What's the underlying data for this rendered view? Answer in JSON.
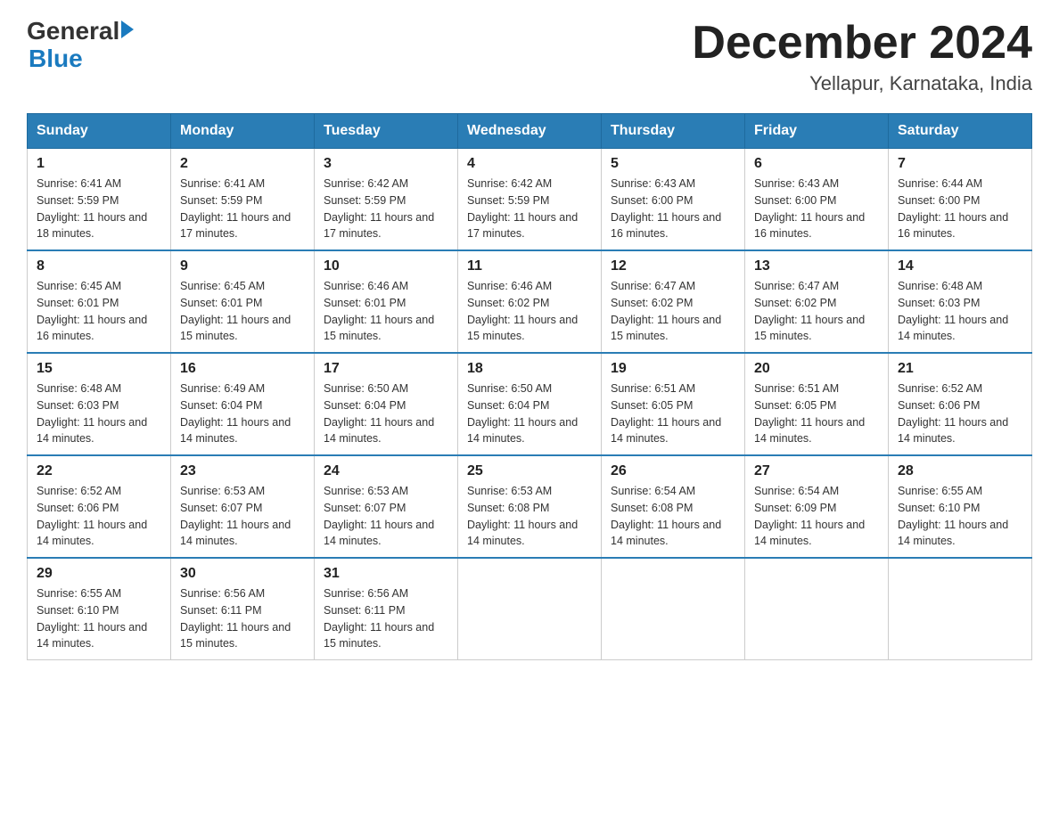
{
  "logo": {
    "text_general": "General",
    "text_blue": "Blue"
  },
  "title": "December 2024",
  "location": "Yellapur, Karnataka, India",
  "headers": [
    "Sunday",
    "Monday",
    "Tuesday",
    "Wednesday",
    "Thursday",
    "Friday",
    "Saturday"
  ],
  "weeks": [
    [
      {
        "day": "1",
        "sunrise": "6:41 AM",
        "sunset": "5:59 PM",
        "daylight": "11 hours and 18 minutes."
      },
      {
        "day": "2",
        "sunrise": "6:41 AM",
        "sunset": "5:59 PM",
        "daylight": "11 hours and 17 minutes."
      },
      {
        "day": "3",
        "sunrise": "6:42 AM",
        "sunset": "5:59 PM",
        "daylight": "11 hours and 17 minutes."
      },
      {
        "day": "4",
        "sunrise": "6:42 AM",
        "sunset": "5:59 PM",
        "daylight": "11 hours and 17 minutes."
      },
      {
        "day": "5",
        "sunrise": "6:43 AM",
        "sunset": "6:00 PM",
        "daylight": "11 hours and 16 minutes."
      },
      {
        "day": "6",
        "sunrise": "6:43 AM",
        "sunset": "6:00 PM",
        "daylight": "11 hours and 16 minutes."
      },
      {
        "day": "7",
        "sunrise": "6:44 AM",
        "sunset": "6:00 PM",
        "daylight": "11 hours and 16 minutes."
      }
    ],
    [
      {
        "day": "8",
        "sunrise": "6:45 AM",
        "sunset": "6:01 PM",
        "daylight": "11 hours and 16 minutes."
      },
      {
        "day": "9",
        "sunrise": "6:45 AM",
        "sunset": "6:01 PM",
        "daylight": "11 hours and 15 minutes."
      },
      {
        "day": "10",
        "sunrise": "6:46 AM",
        "sunset": "6:01 PM",
        "daylight": "11 hours and 15 minutes."
      },
      {
        "day": "11",
        "sunrise": "6:46 AM",
        "sunset": "6:02 PM",
        "daylight": "11 hours and 15 minutes."
      },
      {
        "day": "12",
        "sunrise": "6:47 AM",
        "sunset": "6:02 PM",
        "daylight": "11 hours and 15 minutes."
      },
      {
        "day": "13",
        "sunrise": "6:47 AM",
        "sunset": "6:02 PM",
        "daylight": "11 hours and 15 minutes."
      },
      {
        "day": "14",
        "sunrise": "6:48 AM",
        "sunset": "6:03 PM",
        "daylight": "11 hours and 14 minutes."
      }
    ],
    [
      {
        "day": "15",
        "sunrise": "6:48 AM",
        "sunset": "6:03 PM",
        "daylight": "11 hours and 14 minutes."
      },
      {
        "day": "16",
        "sunrise": "6:49 AM",
        "sunset": "6:04 PM",
        "daylight": "11 hours and 14 minutes."
      },
      {
        "day": "17",
        "sunrise": "6:50 AM",
        "sunset": "6:04 PM",
        "daylight": "11 hours and 14 minutes."
      },
      {
        "day": "18",
        "sunrise": "6:50 AM",
        "sunset": "6:04 PM",
        "daylight": "11 hours and 14 minutes."
      },
      {
        "day": "19",
        "sunrise": "6:51 AM",
        "sunset": "6:05 PM",
        "daylight": "11 hours and 14 minutes."
      },
      {
        "day": "20",
        "sunrise": "6:51 AM",
        "sunset": "6:05 PM",
        "daylight": "11 hours and 14 minutes."
      },
      {
        "day": "21",
        "sunrise": "6:52 AM",
        "sunset": "6:06 PM",
        "daylight": "11 hours and 14 minutes."
      }
    ],
    [
      {
        "day": "22",
        "sunrise": "6:52 AM",
        "sunset": "6:06 PM",
        "daylight": "11 hours and 14 minutes."
      },
      {
        "day": "23",
        "sunrise": "6:53 AM",
        "sunset": "6:07 PM",
        "daylight": "11 hours and 14 minutes."
      },
      {
        "day": "24",
        "sunrise": "6:53 AM",
        "sunset": "6:07 PM",
        "daylight": "11 hours and 14 minutes."
      },
      {
        "day": "25",
        "sunrise": "6:53 AM",
        "sunset": "6:08 PM",
        "daylight": "11 hours and 14 minutes."
      },
      {
        "day": "26",
        "sunrise": "6:54 AM",
        "sunset": "6:08 PM",
        "daylight": "11 hours and 14 minutes."
      },
      {
        "day": "27",
        "sunrise": "6:54 AM",
        "sunset": "6:09 PM",
        "daylight": "11 hours and 14 minutes."
      },
      {
        "day": "28",
        "sunrise": "6:55 AM",
        "sunset": "6:10 PM",
        "daylight": "11 hours and 14 minutes."
      }
    ],
    [
      {
        "day": "29",
        "sunrise": "6:55 AM",
        "sunset": "6:10 PM",
        "daylight": "11 hours and 14 minutes."
      },
      {
        "day": "30",
        "sunrise": "6:56 AM",
        "sunset": "6:11 PM",
        "daylight": "11 hours and 15 minutes."
      },
      {
        "day": "31",
        "sunrise": "6:56 AM",
        "sunset": "6:11 PM",
        "daylight": "11 hours and 15 minutes."
      },
      null,
      null,
      null,
      null
    ]
  ]
}
